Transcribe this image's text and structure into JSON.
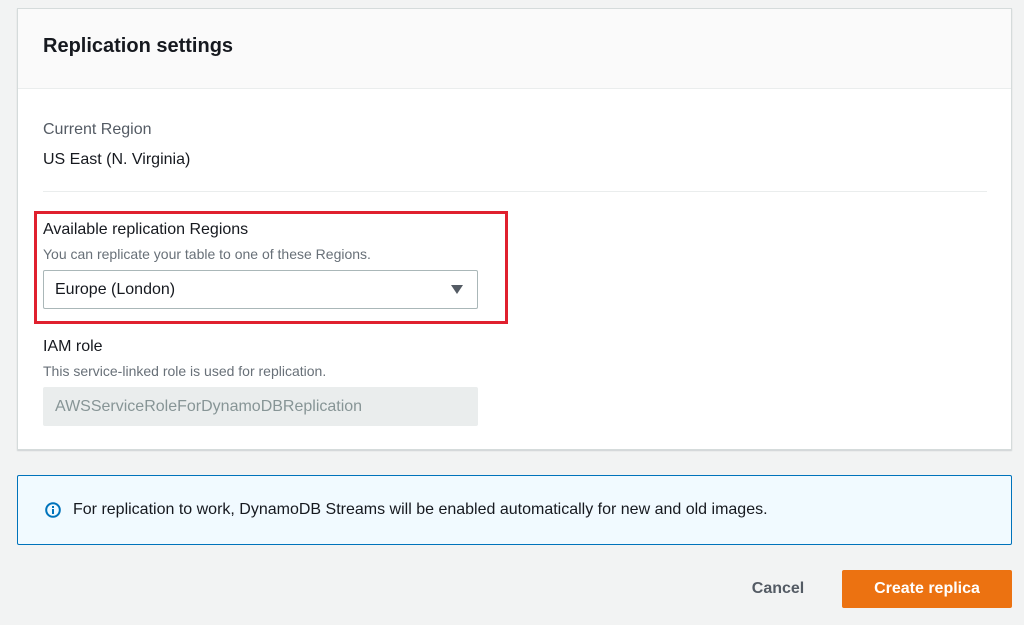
{
  "panel": {
    "title": "Replication settings",
    "current_region": {
      "label": "Current Region",
      "value": "US East (N. Virginia)"
    },
    "available_regions": {
      "label": "Available replication Regions",
      "description": "You can replicate your table to one of these Regions.",
      "selected": "Europe (London)",
      "icon": "caret-down-icon"
    },
    "iam_role": {
      "label": "IAM role",
      "description": "This service-linked role is used for replication.",
      "value": "AWSServiceRoleForDynamoDBReplication"
    }
  },
  "info": {
    "icon": "info-icon",
    "text": "For replication to work, DynamoDB Streams will be enabled automatically for new and old images."
  },
  "actions": {
    "cancel_label": "Cancel",
    "create_label": "Create replica"
  },
  "colors": {
    "highlight_border": "#e0202e",
    "primary_button": "#ec7211",
    "info_border": "#0073bb",
    "info_background": "#f1faff"
  }
}
